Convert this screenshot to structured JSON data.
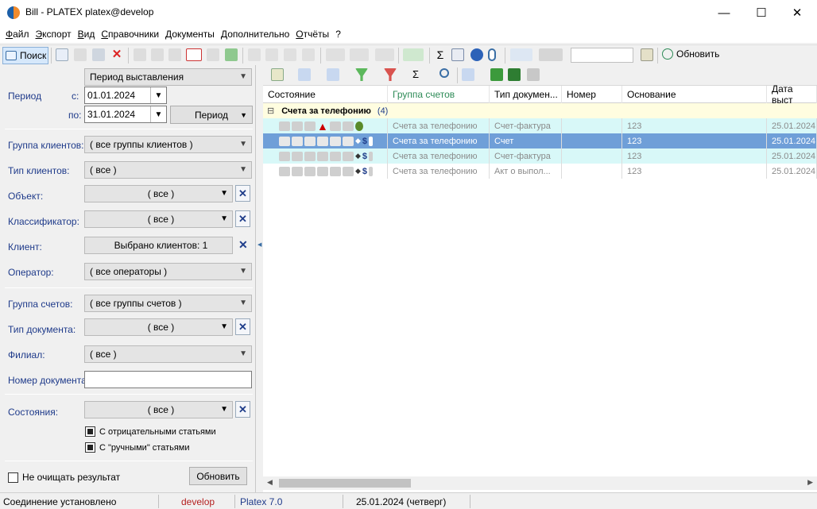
{
  "window": {
    "title": "Bill - PLATEX platex@develop",
    "minimize": "—",
    "maximize": "☐",
    "close": "✕"
  },
  "menu": [
    "Файл",
    "Экспорт",
    "Вид",
    "Справочники",
    "Документы",
    "Дополнительно",
    "Отчёты",
    "?"
  ],
  "toolbar": {
    "search_label": "Поиск",
    "refresh_label": "Обновить",
    "search_value": ""
  },
  "filters": {
    "period_type": "Период выставления",
    "period_label": "Период",
    "from_label": "с:",
    "from_value": "01.01.2024",
    "to_label": "по:",
    "to_value": "31.01.2024",
    "period_button": "Период",
    "client_group_label": "Группа клиентов:",
    "client_group_value": "( все группы клиентов )",
    "client_type_label": "Тип клиентов:",
    "client_type_value": "( все )",
    "object_label": "Объект:",
    "object_value": "( все )",
    "classifier_label": "Классификатор:",
    "classifier_value": "( все )",
    "client_label": "Клиент:",
    "client_value": "Выбрано клиентов: 1",
    "operator_label": "Оператор:",
    "operator_value": "( все операторы )",
    "account_group_label": "Группа счетов:",
    "account_group_value": "( все группы счетов )",
    "doc_type_label": "Тип документа:",
    "doc_type_value": "( все )",
    "branch_label": "Филиал:",
    "branch_value": "( все )",
    "doc_number_label": "Номер документа:",
    "doc_number_value": "",
    "states_label": "Состояния:",
    "states_value": "( все )",
    "negative_items_label": "С отрицательными статьями",
    "negative_items_checked": true,
    "manual_items_label": "С \"ручными\" статьями",
    "manual_items_checked": true,
    "keep_results_label": "Не очищать результат",
    "keep_results_checked": false,
    "refresh_button": "Обновить"
  },
  "grid": {
    "columns": [
      "Состояние",
      "Группа счетов",
      "Тип докумен...",
      "Номер",
      "Основание",
      "Дата выст"
    ],
    "group": {
      "title": "Счета за телефонию",
      "count": "(4)",
      "toggle": "⊟"
    },
    "rows": [
      {
        "group": "Счета за телефонию",
        "doc_type": "Счет-фактура",
        "number": "",
        "basis": "123",
        "date": "25.01.2024"
      },
      {
        "group": "Счета за телефонию",
        "doc_type": "Счет",
        "number": "",
        "basis": "123",
        "date": "25.01.2024"
      },
      {
        "group": "Счета за телефонию",
        "doc_type": "Счет-фактура",
        "number": "",
        "basis": "123",
        "date": "25.01.2024"
      },
      {
        "group": "Счета за телефонию",
        "doc_type": "Акт о выпол...",
        "number": "",
        "basis": "123",
        "date": "25.01.2024"
      }
    ]
  },
  "status": {
    "connection": "Соединение установлено",
    "database": "develop",
    "version": "Platex 7.0",
    "date": "25.01.2024 (четверг)"
  },
  "colors": {
    "selected_row": "#6f9fd8",
    "alt_row": "#d8f8f8",
    "group_row": "#fffde0",
    "label": "#1e3a8a",
    "db_name": "#b42020"
  }
}
